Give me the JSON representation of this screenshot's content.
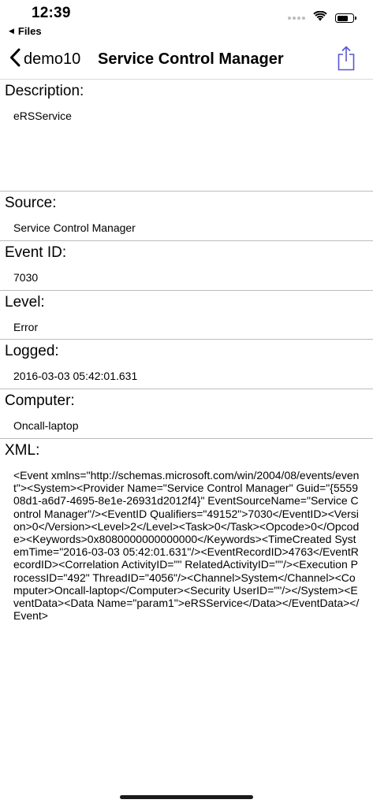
{
  "status_bar": {
    "time": "12:39",
    "back_app": "Files",
    "back_app_icon": "triangle-left-icon",
    "icons": [
      "signal-icon",
      "wifi-icon",
      "battery-icon"
    ]
  },
  "nav": {
    "back_label": "demo10",
    "back_icon": "chevron-left-icon",
    "title": "Service Control Manager",
    "share_icon": "share-icon",
    "accent_color": "#5856d6"
  },
  "sections": {
    "description": {
      "label": "Description:",
      "value": "eRSService"
    },
    "source": {
      "label": "Source:",
      "value": "Service Control Manager"
    },
    "event_id": {
      "label": "Event ID:",
      "value": "7030"
    },
    "level": {
      "label": "Level:",
      "value": "Error"
    },
    "logged": {
      "label": "Logged:",
      "value": "2016-03-03 05:42:01.631"
    },
    "computer": {
      "label": "Computer:",
      "value": "Oncall-laptop"
    },
    "xml": {
      "label": "XML:",
      "value": "<Event xmlns=\"http://schemas.microsoft.com/win/2004/08/events/event\"><System><Provider Name=\"Service Control Manager\" Guid=\"{555908d1-a6d7-4695-8e1e-26931d2012f4}\" EventSourceName=\"Service Control Manager\"/><EventID Qualifiers=\"49152\">7030</EventID><Version>0</Version><Level>2</Level><Task>0</Task><Opcode>0</Opcode><Keywords>0x8080000000000000</Keywords><TimeCreated SystemTime=\"2016-03-03 05:42:01.631\"/><EventRecordID>4763</EventRecordID><Correlation ActivityID=\"\" RelatedActivityID=\"\"/><Execution ProcessID=\"492\" ThreadID=\"4056\"/><Channel>System</Channel><Computer>Oncall-laptop</Computer><Security UserID=\"\"/></System><EventData><Data Name=\"param1\">eRSService</Data></EventData></Event>"
    }
  }
}
